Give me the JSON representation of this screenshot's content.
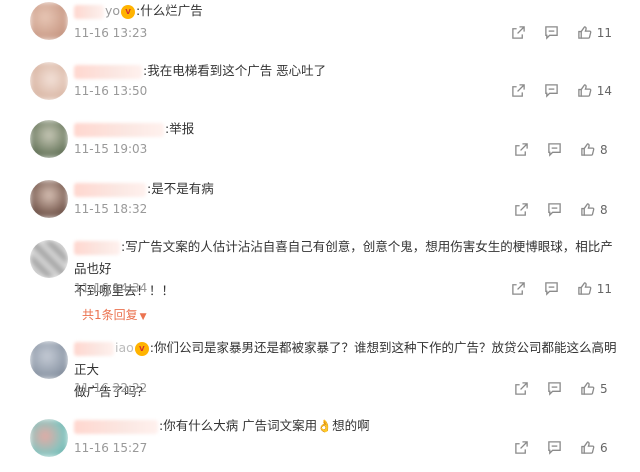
{
  "comments": [
    {
      "user": "yo",
      "has_badge": true,
      "text": ":什么烂广告",
      "time": "11-16 13:23",
      "likes": "11",
      "avatar_color": "#d9b7a6"
    },
    {
      "user": "",
      "has_badge": false,
      "text": ":我在电梯看到这个广告 恶心吐了",
      "time": "11-16 13:50",
      "likes": "14",
      "avatar_color": "#e6cfc4"
    },
    {
      "user": "",
      "has_badge": false,
      "text": ":举报",
      "time": "11-15 19:03",
      "likes": "8",
      "avatar_color": "#7c8a74"
    },
    {
      "user": "",
      "has_badge": false,
      "text": ":是不是有病",
      "time": "11-15 18:32",
      "likes": "8",
      "avatar_color": "#8a6f64"
    },
    {
      "user": "",
      "has_badge": false,
      "text_lines": [
        ":写广告文案的人估计沾沾自喜自己有创意，创意个鬼，想用伤害女生的梗博眼球，相比产品也好",
        "不到哪里去！！！"
      ],
      "time": "11-16 14:34",
      "likes": "11",
      "avatar_color": "#bdbdbd",
      "replies_label": "共1条回复"
    },
    {
      "user": "iao",
      "has_badge": true,
      "text_lines": [
        ":你们公司是家暴男还是都被家暴了？谁想到这种下作的广告？放贷公司都能这么高明正大",
        "做广告了吗？"
      ],
      "time": "11-16 22:22",
      "likes": "5",
      "avatar_color": "#9aa3b0"
    },
    {
      "user": "",
      "has_badge": false,
      "text_before_emoji": ":你有什么大病 广告词文案用",
      "emoji": "👌",
      "text_after_emoji": "想的啊",
      "time": "11-16 15:27",
      "likes": "6",
      "avatar_color": "#86c5c0"
    }
  ],
  "icons": {
    "forward": "forward-icon",
    "comment": "comment-icon",
    "like": "thumbs-up-icon"
  },
  "colors": {
    "accent": "#eb7350",
    "meta": "#999999",
    "text": "#333333"
  }
}
